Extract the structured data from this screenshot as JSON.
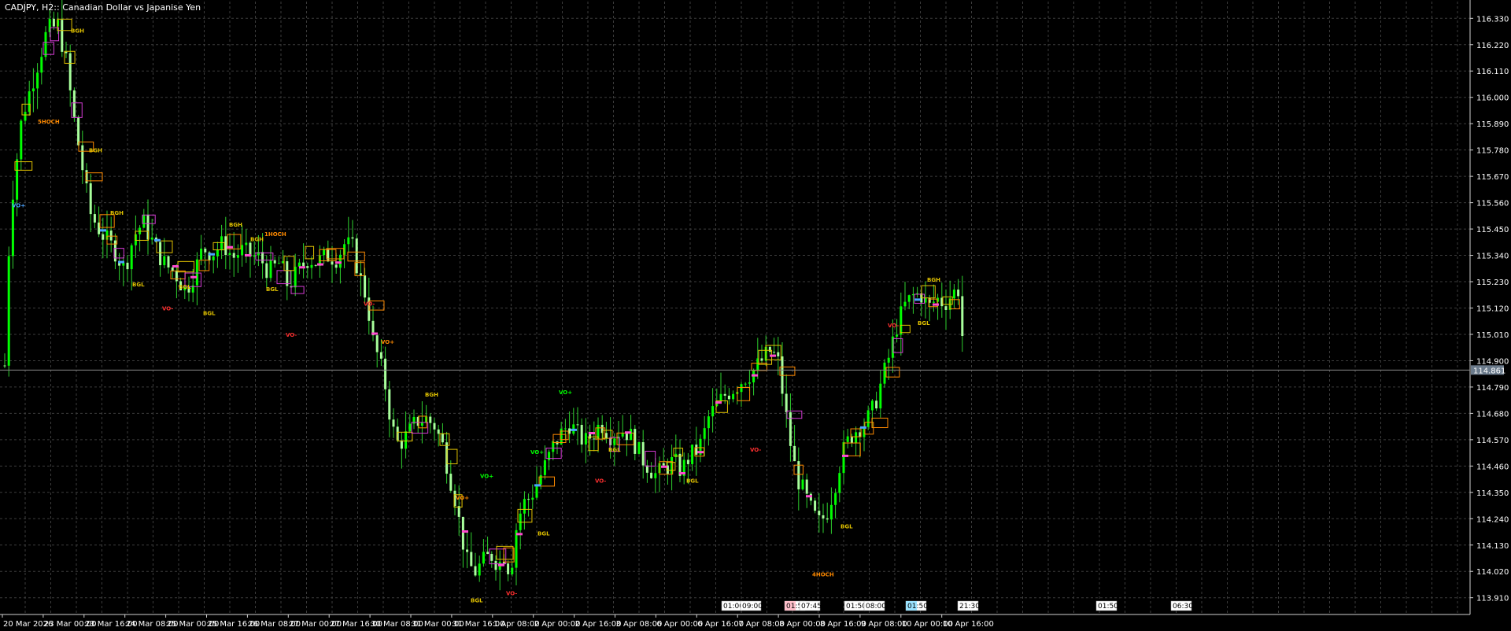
{
  "window": {
    "title": "CADJPY, H2:: Canadian Dollar vs Japanise Yen"
  },
  "colors": {
    "background": "#000000",
    "grid": "#3c3c3c",
    "axis": "#d0d0d0",
    "text": "#ffffff",
    "candle_bull": "#00ff00",
    "candle_bear": "#a8ff9c",
    "wick": "#2fd12f",
    "price_line": "#8a8a8a",
    "price_tag_bg": "#6b7b8c",
    "box_yellow": "#e1c200",
    "box_magenta": "#d43bd4",
    "box_orange": "#ff8a00",
    "label_pink": "#ff4ad0",
    "label_red": "#ff2f2f",
    "label_blue": "#4aa3ff"
  },
  "chart_data": {
    "type": "candlestick",
    "symbol": "CADJPY",
    "timeframe": "H2",
    "ylim": [
      113.84,
      116.4
    ],
    "y_ticks": [
      "116.330",
      "116.220",
      "116.110",
      "116.000",
      "115.890",
      "115.780",
      "115.670",
      "115.560",
      "115.450",
      "115.340",
      "115.230",
      "115.120",
      "115.010",
      "114.900",
      "114.790",
      "114.680",
      "114.570",
      "114.460",
      "114.350",
      "114.240",
      "114.130",
      "114.020",
      "113.910"
    ],
    "current_price": "114.861",
    "x_labels": [
      "20 Mar 2026",
      "23 Mar 00:00",
      "23 Mar 16:00",
      "24 Mar 08:00",
      "25 Mar 00:00",
      "25 Mar 16:00",
      "26 Mar 08:00",
      "27 Mar 00:00",
      "27 Mar 16:00",
      "30 Mar 08:00",
      "31 Mar 00:00",
      "31 Mar 16:00",
      "1 Apr 08:00",
      "2 Apr 00:00",
      "2 Apr 16:00",
      "3 Apr 08:00",
      "6 Apr 00:00",
      "6 Apr 16:00",
      "7 Apr 08:00",
      "8 Apr 00:00",
      "8 Apr 16:00",
      "9 Apr 08:00",
      "10 Apr 00:00",
      "10 Apr 16:00"
    ],
    "close_path": [
      [
        115.3,
        10
      ],
      [
        115.6,
        16
      ],
      [
        115.92,
        28
      ],
      [
        116.05,
        40
      ],
      [
        116.28,
        60
      ],
      [
        116.3,
        74
      ],
      [
        116.15,
        84
      ],
      [
        115.95,
        92
      ],
      [
        115.72,
        104
      ],
      [
        115.52,
        114
      ],
      [
        115.46,
        124
      ],
      [
        115.41,
        134
      ],
      [
        115.36,
        146
      ],
      [
        115.28,
        158
      ],
      [
        115.42,
        170
      ],
      [
        115.48,
        182
      ],
      [
        115.38,
        196
      ],
      [
        115.3,
        210
      ],
      [
        115.27,
        222
      ],
      [
        115.19,
        236
      ],
      [
        115.28,
        248
      ],
      [
        115.37,
        258
      ],
      [
        115.35,
        270
      ],
      [
        115.39,
        284
      ],
      [
        115.33,
        296
      ],
      [
        115.36,
        306
      ],
      [
        115.34,
        318
      ],
      [
        115.33,
        330
      ],
      [
        115.27,
        342
      ],
      [
        115.31,
        356
      ],
      [
        115.21,
        366
      ],
      [
        115.27,
        378
      ],
      [
        115.33,
        392
      ],
      [
        115.31,
        402
      ],
      [
        115.34,
        416
      ],
      [
        115.33,
        428
      ],
      [
        115.39,
        438
      ],
      [
        115.37,
        448
      ],
      [
        115.24,
        458
      ],
      [
        115.16,
        466
      ],
      [
        114.98,
        474
      ],
      [
        114.9,
        482
      ],
      [
        114.79,
        490
      ],
      [
        114.62,
        498
      ],
      [
        114.55,
        506
      ],
      [
        114.59,
        518
      ],
      [
        114.65,
        530
      ],
      [
        114.66,
        540
      ],
      [
        114.63,
        552
      ],
      [
        114.55,
        562
      ],
      [
        114.44,
        570
      ],
      [
        114.33,
        578
      ],
      [
        114.18,
        586
      ],
      [
        114.05,
        594
      ],
      [
        114.02,
        604
      ],
      [
        114.06,
        614
      ],
      [
        114.09,
        624
      ],
      [
        114.05,
        634
      ],
      [
        114.1,
        642
      ],
      [
        114.0,
        648
      ],
      [
        114.2,
        656
      ],
      [
        114.3,
        664
      ],
      [
        114.33,
        674
      ],
      [
        114.4,
        684
      ],
      [
        114.47,
        694
      ],
      [
        114.55,
        704
      ],
      [
        114.6,
        714
      ],
      [
        114.64,
        724
      ],
      [
        114.59,
        734
      ],
      [
        114.56,
        744
      ],
      [
        114.6,
        754
      ],
      [
        114.64,
        764
      ],
      [
        114.59,
        776
      ],
      [
        114.61,
        788
      ],
      [
        114.6,
        798
      ],
      [
        114.56,
        806
      ],
      [
        114.5,
        814
      ],
      [
        114.46,
        824
      ],
      [
        114.42,
        834
      ],
      [
        114.45,
        844
      ],
      [
        114.48,
        856
      ],
      [
        114.44,
        866
      ],
      [
        114.5,
        876
      ],
      [
        114.52,
        884
      ],
      [
        114.56,
        892
      ],
      [
        114.66,
        900
      ],
      [
        114.71,
        910
      ],
      [
        114.76,
        922
      ],
      [
        114.79,
        934
      ],
      [
        114.83,
        946
      ],
      [
        114.86,
        958
      ],
      [
        114.9,
        968
      ],
      [
        114.94,
        978
      ],
      [
        114.91,
        988
      ],
      [
        114.73,
        996
      ],
      [
        114.56,
        1004
      ],
      [
        114.42,
        1012
      ],
      [
        114.36,
        1020
      ],
      [
        114.28,
        1030
      ],
      [
        114.22,
        1040
      ],
      [
        114.26,
        1050
      ],
      [
        114.37,
        1060
      ],
      [
        114.51,
        1070
      ],
      [
        114.58,
        1080
      ],
      [
        114.62,
        1090
      ],
      [
        114.64,
        1100
      ],
      [
        114.7,
        1110
      ],
      [
        114.81,
        1120
      ],
      [
        114.92,
        1130
      ],
      [
        115.05,
        1140
      ],
      [
        115.13,
        1150
      ],
      [
        115.17,
        1160
      ],
      [
        115.18,
        1170
      ],
      [
        115.12,
        1180
      ],
      [
        115.16,
        1190
      ],
      [
        115.14,
        1200
      ],
      [
        115.18,
        1210
      ],
      [
        115.2,
        1218
      ],
      [
        115.09,
        1222
      ],
      [
        114.88,
        1224
      ]
    ]
  },
  "annotations": {
    "labels": [
      {
        "text": "BGH",
        "price": 116.28,
        "x": 90,
        "c": "y"
      },
      {
        "text": "BGH",
        "price": 115.78,
        "x": 113,
        "c": "y"
      },
      {
        "text": "BGH",
        "price": 115.52,
        "x": 140,
        "c": "y"
      },
      {
        "text": "BGH",
        "price": 115.47,
        "x": 291,
        "c": "y"
      },
      {
        "text": "BGH",
        "price": 115.41,
        "x": 318,
        "c": "y"
      },
      {
        "text": "BGH",
        "price": 114.76,
        "x": 540,
        "c": "y"
      },
      {
        "text": "BGH",
        "price": 115.24,
        "x": 1178,
        "c": "y"
      },
      {
        "text": "BGL",
        "price": 115.22,
        "x": 168,
        "c": "y"
      },
      {
        "text": "BGL",
        "price": 115.21,
        "x": 227,
        "c": "y"
      },
      {
        "text": "BGL",
        "price": 115.1,
        "x": 258,
        "c": "y"
      },
      {
        "text": "BGL",
        "price": 115.2,
        "x": 338,
        "c": "y"
      },
      {
        "text": "BGL",
        "price": 113.9,
        "x": 598,
        "c": "y"
      },
      {
        "text": "BGL",
        "price": 114.18,
        "x": 683,
        "c": "y"
      },
      {
        "text": "BGL",
        "price": 114.53,
        "x": 773,
        "c": "y"
      },
      {
        "text": "BGL",
        "price": 114.4,
        "x": 872,
        "c": "y"
      },
      {
        "text": "BGL",
        "price": 114.21,
        "x": 1068,
        "c": "y"
      },
      {
        "text": "BGL",
        "price": 115.06,
        "x": 1166,
        "c": "y"
      },
      {
        "text": "1HOCH",
        "price": 115.43,
        "x": 336,
        "c": "o"
      },
      {
        "text": "5HOCH",
        "price": 115.9,
        "x": 48,
        "c": "o"
      },
      {
        "text": "4HOCH",
        "price": 114.01,
        "x": 1032,
        "c": "o"
      },
      {
        "text": "VO+",
        "price": 115.55,
        "x": 15,
        "c": "b"
      },
      {
        "text": "VO+",
        "price": 114.98,
        "x": 484,
        "c": "o"
      },
      {
        "text": "VO+",
        "price": 114.33,
        "x": 579,
        "c": "o"
      },
      {
        "text": "VO-",
        "price": 115.12,
        "x": 206,
        "c": "r"
      },
      {
        "text": "VO-",
        "price": 115.14,
        "x": 462,
        "c": "r"
      },
      {
        "text": "VO-",
        "price": 115.01,
        "x": 363,
        "c": "r"
      },
      {
        "text": "VO-",
        "price": 113.93,
        "x": 643,
        "c": "r"
      },
      {
        "text": "VO-",
        "price": 114.4,
        "x": 756,
        "c": "r"
      },
      {
        "text": "VO-",
        "price": 114.53,
        "x": 953,
        "c": "r"
      },
      {
        "text": "VO-",
        "price": 115.05,
        "x": 1128,
        "c": "r"
      },
      {
        "text": "VO+",
        "price": 114.42,
        "x": 610,
        "c": "g"
      },
      {
        "text": "VO+",
        "price": 114.77,
        "x": 710,
        "c": "g"
      },
      {
        "text": "VO+",
        "price": 114.52,
        "x": 674,
        "c": "g"
      }
    ],
    "time_tags": [
      {
        "text": "01:00",
        "x": 917,
        "hl": ""
      },
      {
        "text": "09:00",
        "x": 941,
        "hl": ""
      },
      {
        "text": "01:50",
        "x": 997,
        "hl": "#ffc0cb"
      },
      {
        "text": "07:45",
        "x": 1016,
        "hl": ""
      },
      {
        "text": "01:50",
        "x": 1073,
        "hl": ""
      },
      {
        "text": "08:00",
        "x": 1098,
        "hl": ""
      },
      {
        "text": "01:50",
        "x": 1151,
        "hl": "#9be3ff"
      },
      {
        "text": "21:30",
        "x": 1217,
        "hl": ""
      },
      {
        "text": "01:50",
        "x": 1393,
        "hl": ""
      },
      {
        "text": "06:30",
        "x": 1488,
        "hl": ""
      }
    ]
  }
}
